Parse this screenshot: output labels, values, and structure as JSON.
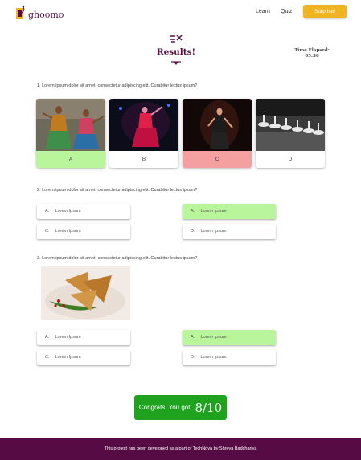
{
  "header": {
    "brand": "ghoomo",
    "nav": [
      "Learn",
      "Quiz"
    ],
    "surprise_label": "Surprise!"
  },
  "results": {
    "title": "Results!",
    "time_label": "Time Elapsed:",
    "time_value": "05:36"
  },
  "questions": [
    {
      "text": "1. Lorem ipsum dolor sit amet, consectetur adipiscing elit. Curabitur lectus ipsum?",
      "images": [
        {
          "label": "A",
          "state": "correct",
          "icon": "dance-photo"
        },
        {
          "label": "B",
          "state": "neutral",
          "icon": "dance-photo"
        },
        {
          "label": "C",
          "state": "wrong",
          "icon": "dance-photo"
        },
        {
          "label": "D",
          "state": "neutral",
          "icon": "dance-photo"
        }
      ]
    },
    {
      "text": "2. Lorem ipsum dolor sit amet, consectetur adipiscing elit. Curabitur lectus ipsum?",
      "options": [
        {
          "letter": "A.",
          "text": "Lorem Ipsum",
          "state": "neutral"
        },
        {
          "letter": "A.",
          "text": "Lorem Ipsum",
          "state": "correct"
        },
        {
          "letter": "C.",
          "text": "Lorem Ipsum",
          "state": "neutral"
        },
        {
          "letter": "D.",
          "text": "Lorem Ipsum",
          "state": "neutral"
        }
      ]
    },
    {
      "text": "3. Lorem ipsum dolor sit amet, consectetur adipiscing elit. Curabitur lectus ipsum?",
      "image_icon": "samosa-photo",
      "options": [
        {
          "letter": "A.",
          "text": "Lorem Ipsum",
          "state": "neutral"
        },
        {
          "letter": "A.",
          "text": "Lorem Ipsum",
          "state": "correct"
        },
        {
          "letter": "C.",
          "text": "Lorem Ipsum",
          "state": "neutral"
        },
        {
          "letter": "D.",
          "text": "Lorem Ipsum",
          "state": "neutral"
        }
      ]
    }
  ],
  "score": {
    "message": "Congrats! You got",
    "value": "8/10"
  },
  "footer": {
    "text": "This project has been developed as a part of TechNova by Shreya Badchariya"
  },
  "colors": {
    "brand": "#5a1040",
    "accent": "#f0b321",
    "correct": "#b9f59a",
    "wrong": "#f5a0a0",
    "score_bg": "#1fa31f",
    "footer_bg": "#560b44"
  }
}
